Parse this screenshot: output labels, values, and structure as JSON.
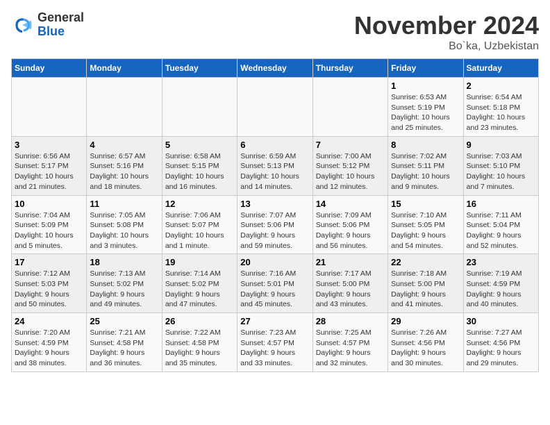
{
  "header": {
    "logo_general": "General",
    "logo_blue": "Blue",
    "month_title": "November 2024",
    "location": "Bo`ka, Uzbekistan"
  },
  "weekdays": [
    "Sunday",
    "Monday",
    "Tuesday",
    "Wednesday",
    "Thursday",
    "Friday",
    "Saturday"
  ],
  "weeks": [
    [
      {
        "day": "",
        "info": ""
      },
      {
        "day": "",
        "info": ""
      },
      {
        "day": "",
        "info": ""
      },
      {
        "day": "",
        "info": ""
      },
      {
        "day": "",
        "info": ""
      },
      {
        "day": "1",
        "info": "Sunrise: 6:53 AM\nSunset: 5:19 PM\nDaylight: 10 hours\nand 25 minutes."
      },
      {
        "day": "2",
        "info": "Sunrise: 6:54 AM\nSunset: 5:18 PM\nDaylight: 10 hours\nand 23 minutes."
      }
    ],
    [
      {
        "day": "3",
        "info": "Sunrise: 6:56 AM\nSunset: 5:17 PM\nDaylight: 10 hours\nand 21 minutes."
      },
      {
        "day": "4",
        "info": "Sunrise: 6:57 AM\nSunset: 5:16 PM\nDaylight: 10 hours\nand 18 minutes."
      },
      {
        "day": "5",
        "info": "Sunrise: 6:58 AM\nSunset: 5:15 PM\nDaylight: 10 hours\nand 16 minutes."
      },
      {
        "day": "6",
        "info": "Sunrise: 6:59 AM\nSunset: 5:13 PM\nDaylight: 10 hours\nand 14 minutes."
      },
      {
        "day": "7",
        "info": "Sunrise: 7:00 AM\nSunset: 5:12 PM\nDaylight: 10 hours\nand 12 minutes."
      },
      {
        "day": "8",
        "info": "Sunrise: 7:02 AM\nSunset: 5:11 PM\nDaylight: 10 hours\nand 9 minutes."
      },
      {
        "day": "9",
        "info": "Sunrise: 7:03 AM\nSunset: 5:10 PM\nDaylight: 10 hours\nand 7 minutes."
      }
    ],
    [
      {
        "day": "10",
        "info": "Sunrise: 7:04 AM\nSunset: 5:09 PM\nDaylight: 10 hours\nand 5 minutes."
      },
      {
        "day": "11",
        "info": "Sunrise: 7:05 AM\nSunset: 5:08 PM\nDaylight: 10 hours\nand 3 minutes."
      },
      {
        "day": "12",
        "info": "Sunrise: 7:06 AM\nSunset: 5:07 PM\nDaylight: 10 hours\nand 1 minute."
      },
      {
        "day": "13",
        "info": "Sunrise: 7:07 AM\nSunset: 5:06 PM\nDaylight: 9 hours\nand 59 minutes."
      },
      {
        "day": "14",
        "info": "Sunrise: 7:09 AM\nSunset: 5:06 PM\nDaylight: 9 hours\nand 56 minutes."
      },
      {
        "day": "15",
        "info": "Sunrise: 7:10 AM\nSunset: 5:05 PM\nDaylight: 9 hours\nand 54 minutes."
      },
      {
        "day": "16",
        "info": "Sunrise: 7:11 AM\nSunset: 5:04 PM\nDaylight: 9 hours\nand 52 minutes."
      }
    ],
    [
      {
        "day": "17",
        "info": "Sunrise: 7:12 AM\nSunset: 5:03 PM\nDaylight: 9 hours\nand 50 minutes."
      },
      {
        "day": "18",
        "info": "Sunrise: 7:13 AM\nSunset: 5:02 PM\nDaylight: 9 hours\nand 49 minutes."
      },
      {
        "day": "19",
        "info": "Sunrise: 7:14 AM\nSunset: 5:02 PM\nDaylight: 9 hours\nand 47 minutes."
      },
      {
        "day": "20",
        "info": "Sunrise: 7:16 AM\nSunset: 5:01 PM\nDaylight: 9 hours\nand 45 minutes."
      },
      {
        "day": "21",
        "info": "Sunrise: 7:17 AM\nSunset: 5:00 PM\nDaylight: 9 hours\nand 43 minutes."
      },
      {
        "day": "22",
        "info": "Sunrise: 7:18 AM\nSunset: 5:00 PM\nDaylight: 9 hours\nand 41 minutes."
      },
      {
        "day": "23",
        "info": "Sunrise: 7:19 AM\nSunset: 4:59 PM\nDaylight: 9 hours\nand 40 minutes."
      }
    ],
    [
      {
        "day": "24",
        "info": "Sunrise: 7:20 AM\nSunset: 4:59 PM\nDaylight: 9 hours\nand 38 minutes."
      },
      {
        "day": "25",
        "info": "Sunrise: 7:21 AM\nSunset: 4:58 PM\nDaylight: 9 hours\nand 36 minutes."
      },
      {
        "day": "26",
        "info": "Sunrise: 7:22 AM\nSunset: 4:58 PM\nDaylight: 9 hours\nand 35 minutes."
      },
      {
        "day": "27",
        "info": "Sunrise: 7:23 AM\nSunset: 4:57 PM\nDaylight: 9 hours\nand 33 minutes."
      },
      {
        "day": "28",
        "info": "Sunrise: 7:25 AM\nSunset: 4:57 PM\nDaylight: 9 hours\nand 32 minutes."
      },
      {
        "day": "29",
        "info": "Sunrise: 7:26 AM\nSunset: 4:56 PM\nDaylight: 9 hours\nand 30 minutes."
      },
      {
        "day": "30",
        "info": "Sunrise: 7:27 AM\nSunset: 4:56 PM\nDaylight: 9 hours\nand 29 minutes."
      }
    ]
  ]
}
